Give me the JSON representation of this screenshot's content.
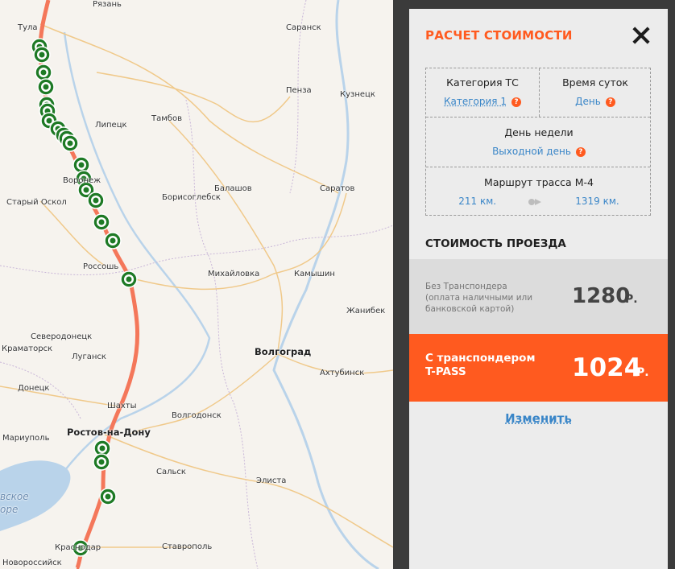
{
  "map": {
    "cities": [
      {
        "id": "ryazan",
        "name": "Рязань"
      },
      {
        "id": "tula",
        "name": "Тула"
      },
      {
        "id": "saransk",
        "name": "Саранск"
      },
      {
        "id": "penza",
        "name": "Пенза"
      },
      {
        "id": "kuznetsk",
        "name": "Кузнецк"
      },
      {
        "id": "tambov",
        "name": "Тамбов"
      },
      {
        "id": "lipetsk",
        "name": "Липецк"
      },
      {
        "id": "voronezh",
        "name": "Воронеж"
      },
      {
        "id": "balashov",
        "name": "Балашов"
      },
      {
        "id": "saratov",
        "name": "Саратов"
      },
      {
        "id": "borisoglebsk",
        "name": "Борисоглебск"
      },
      {
        "id": "stary-oskol",
        "name": "Старый Оскол"
      },
      {
        "id": "rossosh",
        "name": "Россошь"
      },
      {
        "id": "mikhaylovka",
        "name": "Михайловка"
      },
      {
        "id": "kamyshin",
        "name": "Камышин"
      },
      {
        "id": "dzhanibek",
        "name": "Жанибек"
      },
      {
        "id": "severodonetsk",
        "name": "Северодонецк"
      },
      {
        "id": "kramatorsk",
        "name": "Краматорск"
      },
      {
        "id": "lugansk",
        "name": "Луганск"
      },
      {
        "id": "volgograd",
        "name": "Волгоград"
      },
      {
        "id": "akhtubinsk",
        "name": "Ахтубинск"
      },
      {
        "id": "donetsk",
        "name": "Донецк"
      },
      {
        "id": "shakhty",
        "name": "Шахты"
      },
      {
        "id": "volgodonsk",
        "name": "Волгодонск"
      },
      {
        "id": "mariupol",
        "name": "Мариуполь"
      },
      {
        "id": "rostov",
        "name": "Ростов-на-Дону"
      },
      {
        "id": "salsk",
        "name": "Сальск"
      },
      {
        "id": "elista",
        "name": "Элиста"
      },
      {
        "id": "azov-sea-1",
        "name": "вское"
      },
      {
        "id": "azov-sea-2",
        "name": "оре"
      },
      {
        "id": "krasnodar",
        "name": "Краснодар"
      },
      {
        "id": "stavropol",
        "name": "Ставрополь"
      },
      {
        "id": "novorossiysk",
        "name": "Новороссийск"
      }
    ],
    "colors": {
      "route": "#f4775a",
      "marker": "#1e7a25",
      "water": "#b9d3ea",
      "road": "#f0c98a"
    }
  },
  "panel": {
    "title": "РАСЧЕТ СТОИМОСТИ",
    "vehicle_category": {
      "label": "Категория ТС",
      "value": "Категория 1"
    },
    "time_of_day": {
      "label": "Время суток",
      "value": "День"
    },
    "day_of_week": {
      "label": "День недели",
      "value": "Выходной день"
    },
    "route": {
      "label": "Маршрут трасса М-4",
      "from": "211 км.",
      "to": "1319 км."
    },
    "help_glyph": "?",
    "section_title": "СТОИМОСТЬ ПРОЕЗДА",
    "cash": {
      "label": "Без Транспондера (оплата наличными или банковской картой)",
      "price": "1280",
      "currency": "Р."
    },
    "tpass": {
      "label": "С транспондером T-PASS",
      "price": "1024",
      "currency": "Р."
    },
    "change_label": "Изменить",
    "colors": {
      "accent": "#ff5a1f",
      "link": "#3a86c8"
    }
  }
}
